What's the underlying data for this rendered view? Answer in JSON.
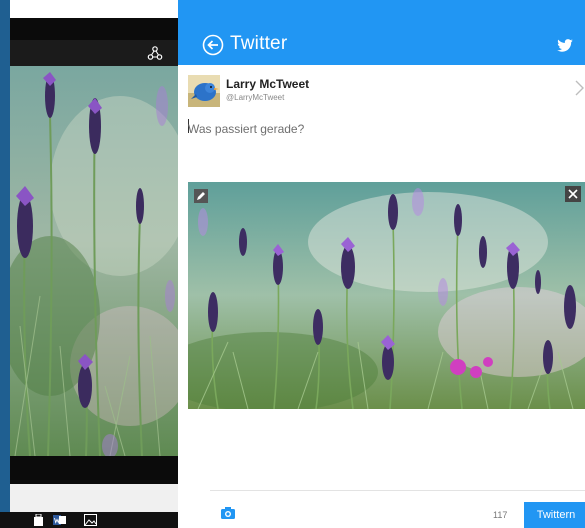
{
  "left_app": {
    "share_icon": "share-icon",
    "taskbar_icons": [
      "windows-store-icon",
      "word-icon",
      "photos-icon"
    ]
  },
  "share_pane": {
    "title": "Twitter",
    "back_icon": "back-arrow-icon",
    "brand_icon": "twitter-bird-icon",
    "account": {
      "name": "Larry McTweet",
      "handle": "@LarryMcTweet"
    },
    "tweet": {
      "value": "",
      "placeholder": "Was passiert gerade?"
    },
    "attachment": {
      "edit_icon": "pencil-icon",
      "remove_icon": "close-icon"
    },
    "footer": {
      "camera_icon": "camera-icon",
      "char_count": "117",
      "submit_label": "Twittern"
    }
  },
  "colors": {
    "accent": "#2196f3",
    "window_strip": "#1f5f91"
  }
}
